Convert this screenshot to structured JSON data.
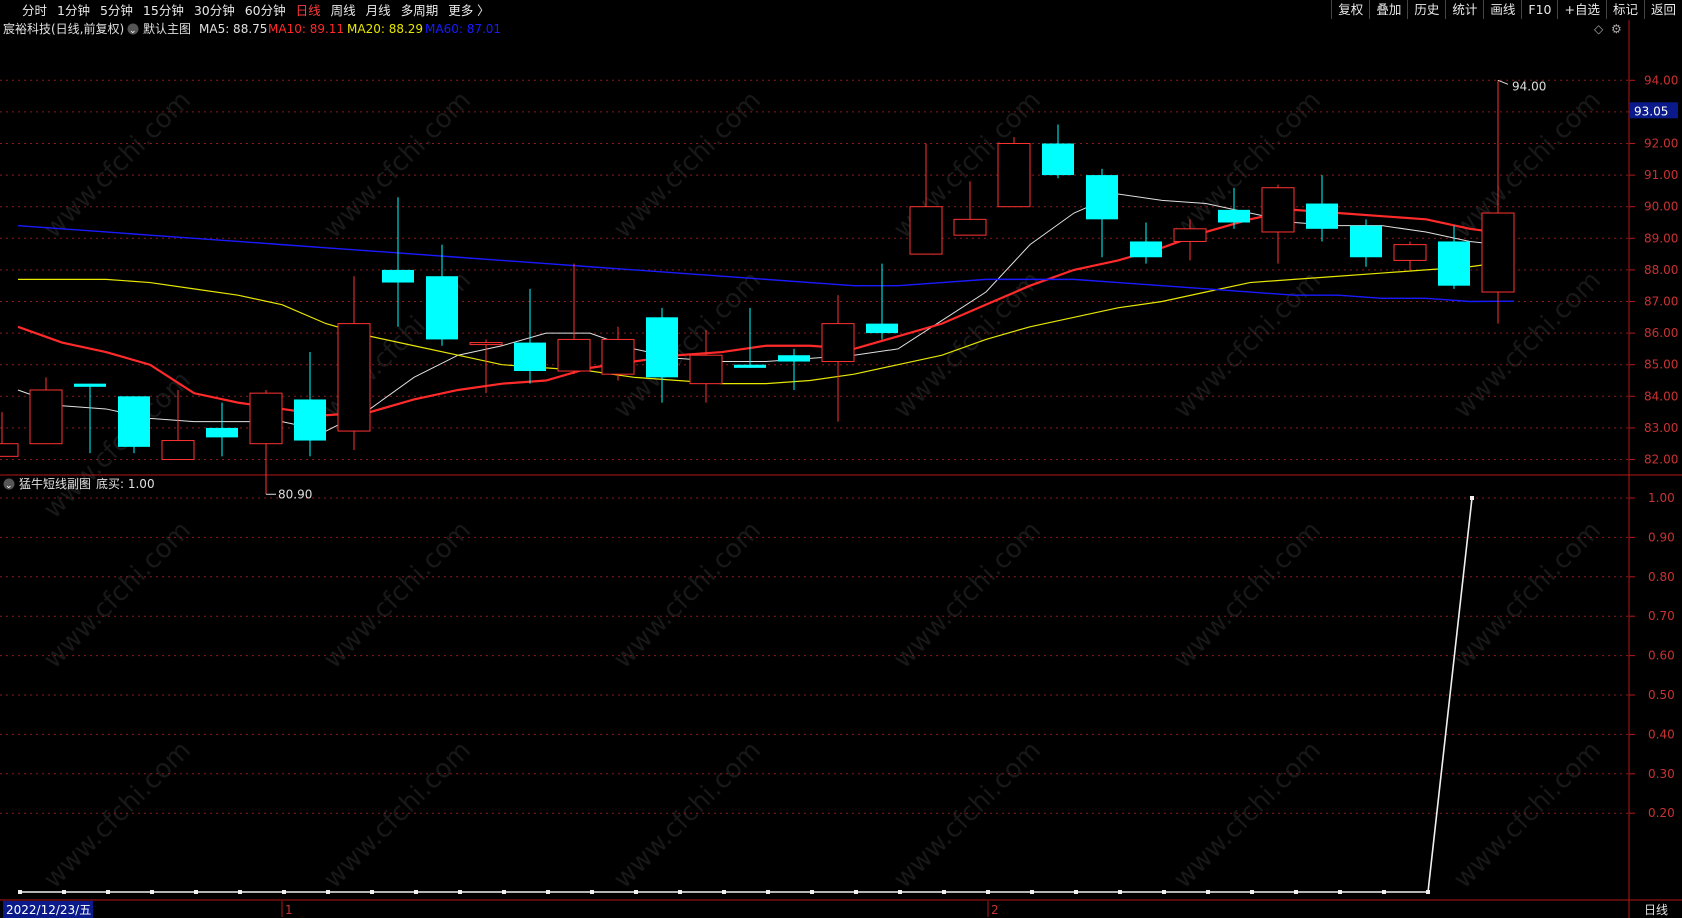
{
  "toolbar": {
    "periods": [
      "分时",
      "1分钟",
      "5分钟",
      "15分钟",
      "30分钟",
      "60分钟",
      "日线",
      "周线",
      "月线",
      "多周期",
      "更多 〉"
    ],
    "active_period": "日线",
    "right_buttons": [
      "复权",
      "叠加",
      "历史",
      "统计",
      "画线",
      "F10",
      "+自选",
      "标记",
      "返回"
    ]
  },
  "main_chart": {
    "stock_title": "宸裕科技(日线,前复权)",
    "template_label": "默认主图",
    "ma": [
      {
        "label": "MA5: 88.75",
        "color": "#e0e0e0"
      },
      {
        "label": "MA10: 89.11",
        "color": "#ff2a2a"
      },
      {
        "label": "MA20: 88.29",
        "color": "#e6e600"
      },
      {
        "label": "MA60: 87.01",
        "color": "#1a1aff"
      }
    ],
    "current_price_tag": "93.05",
    "high_marker": "94.00",
    "low_marker": "80.90",
    "price_axis": [
      "94.00",
      "93.00",
      "92.00",
      "91.00",
      "90.00",
      "89.00",
      "88.00",
      "87.00",
      "86.00",
      "85.00",
      "84.00",
      "83.00",
      "82.00"
    ]
  },
  "sub_chart": {
    "title": "猛牛短线副图",
    "value_label": "底买: 1.00",
    "axis": [
      "1.00",
      "0.90",
      "0.80",
      "0.70",
      "0.60",
      "0.50",
      "0.40",
      "0.30",
      "0.20"
    ]
  },
  "bottom": {
    "date_label": "2022/12/23/五",
    "month_marks": [
      "1",
      "2"
    ],
    "period_label": "日线"
  },
  "watermark": "www.cfchi.com",
  "colors": {
    "up": "#ff3232",
    "down": "#00ffff",
    "ma5": "#e0e0e0",
    "ma10": "#ff2a2a",
    "ma20": "#e6e600",
    "ma60": "#1a1aff",
    "grid": "#8b1a1a",
    "axis": "#b31818"
  },
  "chart_data": [
    {
      "type": "candlestick",
      "title": "宸裕科技(日线,前复权)",
      "ylim": [
        80.5,
        94.5
      ],
      "candles": [
        {
          "o": 82.1,
          "c": 82.5,
          "h": 83.5,
          "l": 82.1
        },
        {
          "o": 82.5,
          "c": 84.2,
          "h": 84.6,
          "l": 82.5
        },
        {
          "o": 84.4,
          "c": 84.3,
          "h": 84.4,
          "l": 82.2
        },
        {
          "o": 84.0,
          "c": 82.4,
          "h": 84.0,
          "l": 82.2
        },
        {
          "o": 82.0,
          "c": 82.6,
          "h": 84.2,
          "l": 82.0
        },
        {
          "o": 83.0,
          "c": 82.7,
          "h": 83.8,
          "l": 82.1
        },
        {
          "o": 82.5,
          "c": 84.1,
          "h": 84.2,
          "l": 80.9
        },
        {
          "o": 83.9,
          "c": 82.6,
          "h": 85.4,
          "l": 82.1
        },
        {
          "o": 82.9,
          "c": 86.3,
          "h": 87.8,
          "l": 82.3
        },
        {
          "o": 88.0,
          "c": 87.6,
          "h": 90.3,
          "l": 86.2
        },
        {
          "o": 87.8,
          "c": 85.8,
          "h": 88.8,
          "l": 85.6
        },
        {
          "o": 85.7,
          "c": 85.7,
          "h": 85.8,
          "l": 84.1
        },
        {
          "o": 85.7,
          "c": 84.8,
          "h": 87.4,
          "l": 84.4
        },
        {
          "o": 84.8,
          "c": 85.8,
          "h": 88.2,
          "l": 84.7
        },
        {
          "o": 84.7,
          "c": 85.8,
          "h": 86.2,
          "l": 84.5
        },
        {
          "o": 86.5,
          "c": 84.6,
          "h": 86.8,
          "l": 83.8
        },
        {
          "o": 84.4,
          "c": 85.3,
          "h": 86.1,
          "l": 83.8
        },
        {
          "o": 85.0,
          "c": 84.9,
          "h": 86.8,
          "l": 84.9
        },
        {
          "o": 85.3,
          "c": 85.1,
          "h": 85.5,
          "l": 84.2
        },
        {
          "o": 85.1,
          "c": 86.3,
          "h": 87.2,
          "l": 83.2
        },
        {
          "o": 86.3,
          "c": 86.0,
          "h": 88.2,
          "l": 85.8
        },
        {
          "o": 88.5,
          "c": 90.0,
          "h": 92.0,
          "l": 88.5
        },
        {
          "o": 89.1,
          "c": 89.6,
          "h": 90.8,
          "l": 89.1
        },
        {
          "o": 90.0,
          "c": 92.0,
          "h": 92.2,
          "l": 90.0
        },
        {
          "o": 92.0,
          "c": 91.0,
          "h": 92.6,
          "l": 90.9
        },
        {
          "o": 91.0,
          "c": 89.6,
          "h": 91.2,
          "l": 88.4
        },
        {
          "o": 88.9,
          "c": 88.4,
          "h": 89.5,
          "l": 88.2
        },
        {
          "o": 88.9,
          "c": 89.3,
          "h": 89.6,
          "l": 88.3
        },
        {
          "o": 89.9,
          "c": 89.5,
          "h": 90.6,
          "l": 89.3
        },
        {
          "o": 89.2,
          "c": 90.6,
          "h": 90.7,
          "l": 88.2
        },
        {
          "o": 90.1,
          "c": 89.3,
          "h": 91.0,
          "l": 88.9
        },
        {
          "o": 89.4,
          "c": 88.4,
          "h": 89.6,
          "l": 88.1
        },
        {
          "o": 88.3,
          "c": 88.8,
          "h": 88.9,
          "l": 88.0
        },
        {
          "o": 88.9,
          "c": 87.5,
          "h": 89.4,
          "l": 87.4
        },
        {
          "o": 87.3,
          "c": 89.8,
          "h": 94.0,
          "l": 86.3
        }
      ],
      "series": [
        {
          "name": "MA5",
          "values": [
            84.2,
            83.7,
            83.6,
            83.3,
            83.2,
            83.2,
            83.2,
            82.9,
            83.6,
            84.6,
            85.3,
            85.6,
            86.0,
            86.0,
            85.5,
            85.2,
            85.1,
            85.1,
            85.2,
            85.3,
            85.5,
            86.4,
            87.3,
            88.8,
            89.8,
            90.4,
            90.2,
            90.1,
            89.8,
            89.5,
            89.4,
            89.4,
            89.2,
            88.9,
            88.75
          ]
        },
        {
          "name": "MA10",
          "values": [
            86.2,
            85.7,
            85.4,
            85.0,
            84.1,
            83.8,
            83.6,
            83.4,
            83.5,
            83.9,
            84.2,
            84.4,
            84.5,
            84.9,
            85.1,
            85.3,
            85.4,
            85.6,
            85.6,
            85.5,
            85.9,
            86.3,
            86.9,
            87.5,
            88.0,
            88.3,
            88.7,
            89.2,
            89.6,
            89.9,
            89.8,
            89.7,
            89.6,
            89.3,
            89.11
          ]
        },
        {
          "name": "MA20",
          "values": [
            87.7,
            87.7,
            87.7,
            87.6,
            87.4,
            87.2,
            86.9,
            86.3,
            85.9,
            85.6,
            85.3,
            85.0,
            84.9,
            84.8,
            84.6,
            84.5,
            84.4,
            84.4,
            84.5,
            84.7,
            85.0,
            85.3,
            85.8,
            86.2,
            86.5,
            86.8,
            87.0,
            87.3,
            87.6,
            87.7,
            87.8,
            87.9,
            88.0,
            88.1,
            88.29
          ]
        },
        {
          "name": "MA60",
          "values": [
            89.4,
            89.3,
            89.2,
            89.1,
            89.0,
            88.9,
            88.8,
            88.7,
            88.6,
            88.5,
            88.4,
            88.3,
            88.2,
            88.1,
            88.0,
            87.9,
            87.8,
            87.7,
            87.6,
            87.5,
            87.5,
            87.6,
            87.7,
            87.7,
            87.7,
            87.6,
            87.5,
            87.4,
            87.3,
            87.2,
            87.2,
            87.1,
            87.1,
            87.0,
            87.01
          ]
        }
      ]
    },
    {
      "type": "line",
      "title": "猛牛短线副图",
      "ylim": [
        0,
        1.0
      ],
      "series": [
        {
          "name": "底买",
          "values": [
            0,
            0,
            0,
            0,
            0,
            0,
            0,
            0,
            0,
            0,
            0,
            0,
            0,
            0,
            0,
            0,
            0,
            0,
            0,
            0,
            0,
            0,
            0,
            0,
            0,
            0,
            0,
            0,
            0,
            0,
            0,
            0,
            0,
            1.0
          ]
        }
      ]
    }
  ]
}
